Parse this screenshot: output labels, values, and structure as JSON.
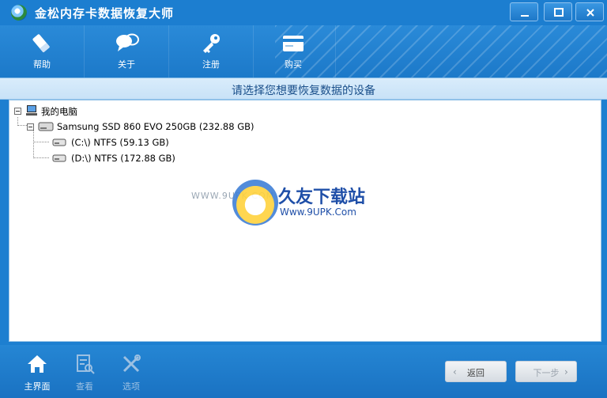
{
  "window": {
    "title": "金松内存卡数据恢复大师",
    "minimize_icon": "minimize-icon",
    "maximize_icon": "maximize-icon",
    "close_icon": "close-icon"
  },
  "toolbar": {
    "items": [
      {
        "label": "帮助",
        "icon": "eraser-icon"
      },
      {
        "label": "关于",
        "icon": "chat-bubbles-icon"
      },
      {
        "label": "注册",
        "icon": "key-icon"
      },
      {
        "label": "购买",
        "icon": "card-icon"
      }
    ]
  },
  "instruction": "请选择您想要恢复数据的设备",
  "tree": {
    "root": {
      "label": "我的电脑",
      "icon": "computer-icon"
    },
    "disk": {
      "label": "Samsung SSD 860 EVO 250GB (232.88 GB)",
      "icon": "hard-drive-icon"
    },
    "partitions": [
      {
        "label": "(C:\\) NTFS (59.13 GB)",
        "icon": "partition-icon"
      },
      {
        "label": "(D:\\) NTFS (172.88 GB)",
        "icon": "partition-icon"
      }
    ]
  },
  "watermark": {
    "url_small": "WWW.9UPK.COM",
    "brand": "久友下载站",
    "url": "Www.9UPK.Com"
  },
  "bottom": {
    "items": [
      {
        "label": "主界面",
        "icon": "home-icon",
        "enabled": true
      },
      {
        "label": "查看",
        "icon": "view-document-icon",
        "enabled": false
      },
      {
        "label": "选项",
        "icon": "tools-icon",
        "enabled": false
      }
    ],
    "back_label": "返回",
    "next_label": "下一步"
  },
  "colors": {
    "accent": "#1d7fd0",
    "subtitle_text": "#1a4f8a",
    "panel_border": "#9cc6e8"
  }
}
